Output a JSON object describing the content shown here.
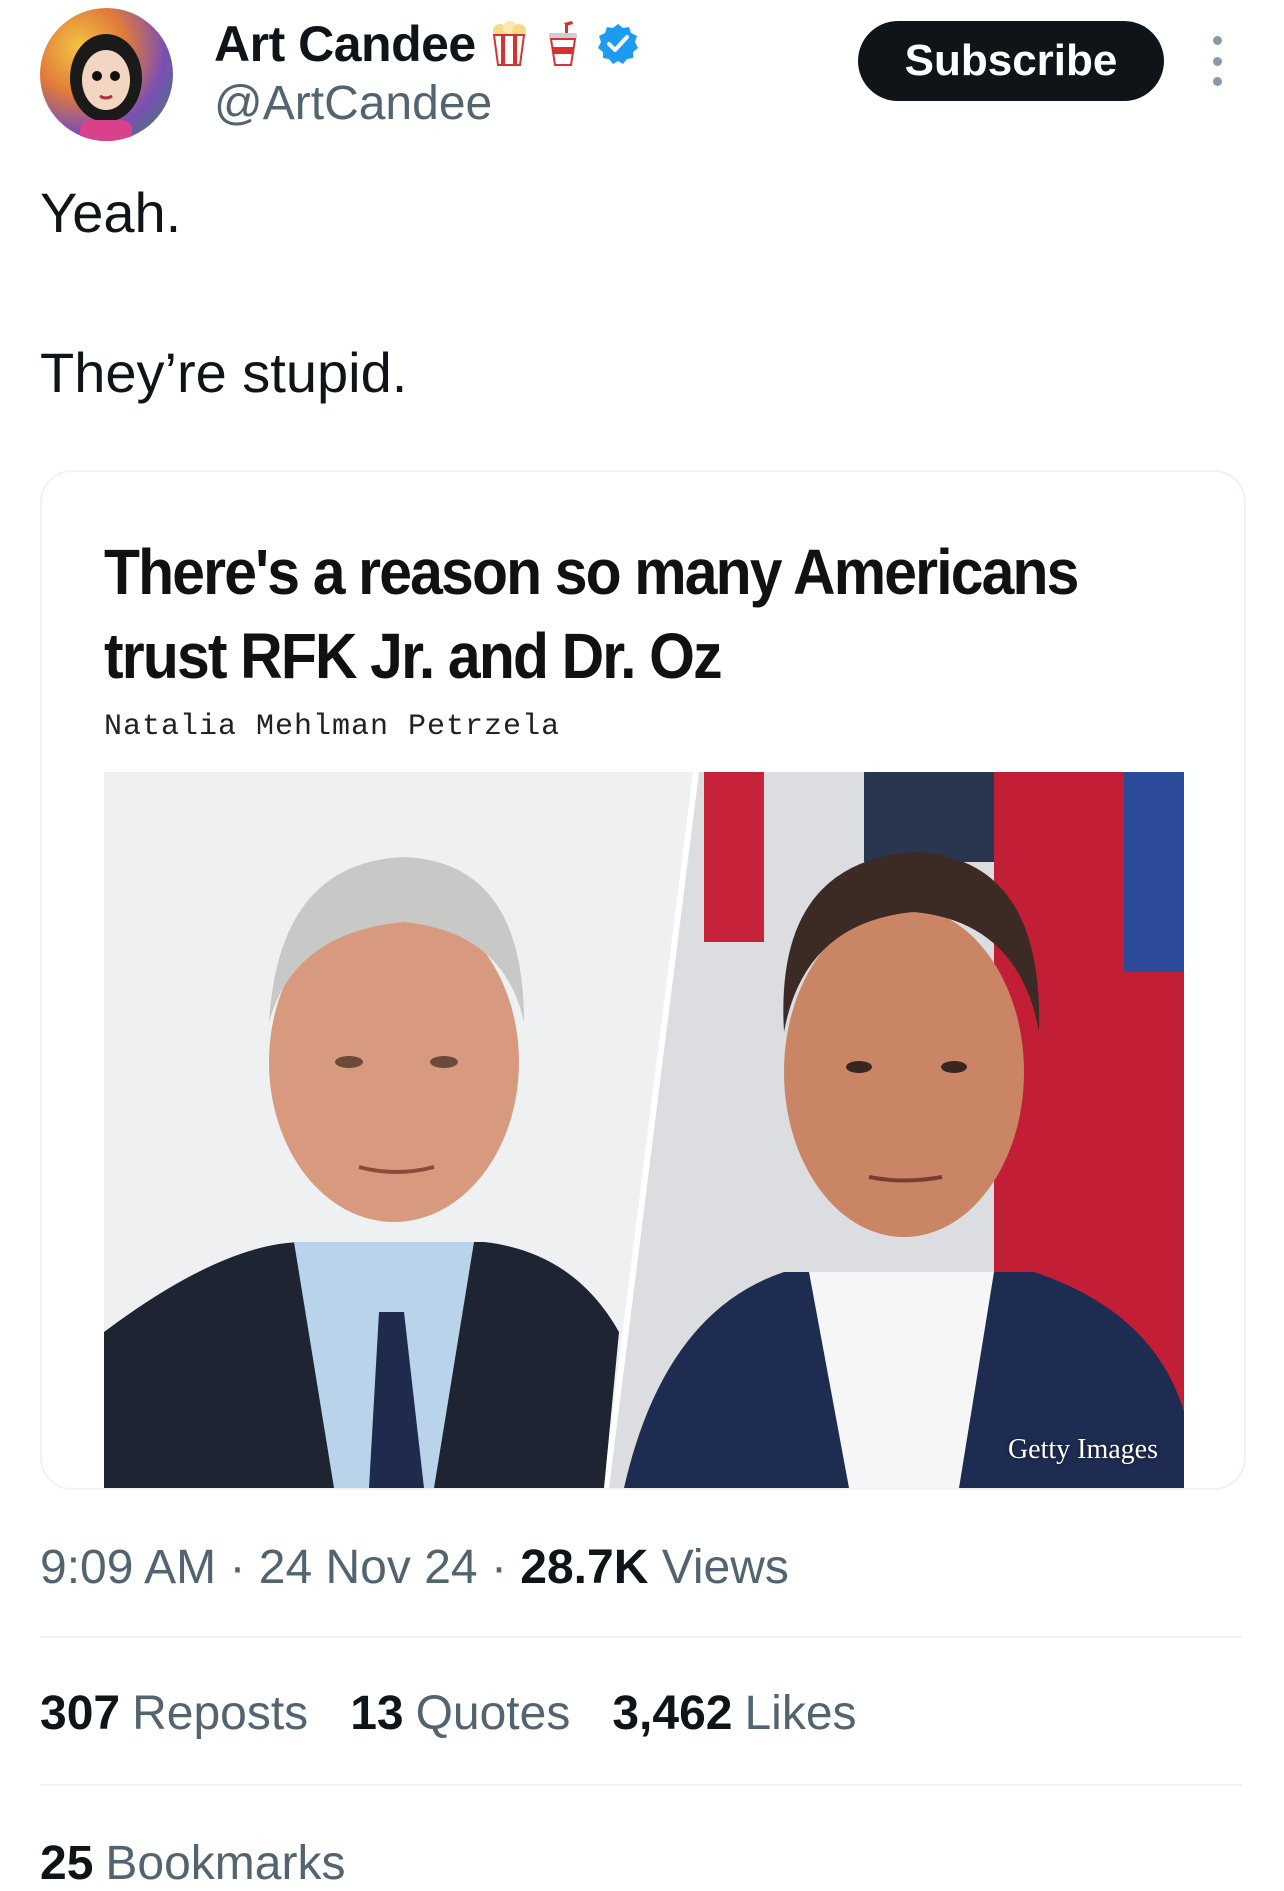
{
  "author": {
    "display_name": "Art Candee",
    "handle": "@ArtCandee",
    "name_emojis": [
      "popcorn-icon",
      "soda-cup-icon"
    ],
    "verified": true
  },
  "header": {
    "subscribe_label": "Subscribe"
  },
  "tweet": {
    "lines": [
      "Yeah.",
      "They’re stupid."
    ]
  },
  "card": {
    "headline": "There's a reason so many Americans trust RFK Jr. and Dr. Oz",
    "byline": "Natalia Mehlman Petrzela",
    "photo_credit": "Getty Images"
  },
  "meta": {
    "time": "9:09 AM",
    "date": "24 Nov 24",
    "views_count": "28.7K",
    "views_label": "Views"
  },
  "stats": {
    "reposts": {
      "count": "307",
      "label": "Reposts"
    },
    "quotes": {
      "count": "13",
      "label": "Quotes"
    },
    "likes": {
      "count": "3,462",
      "label": "Likes"
    },
    "bookmarks": {
      "count": "25",
      "label": "Bookmarks"
    }
  },
  "colors": {
    "text_primary": "#0f1419",
    "text_secondary": "#536471",
    "verified_blue": "#1d9bf0",
    "border": "#eff3f4"
  }
}
